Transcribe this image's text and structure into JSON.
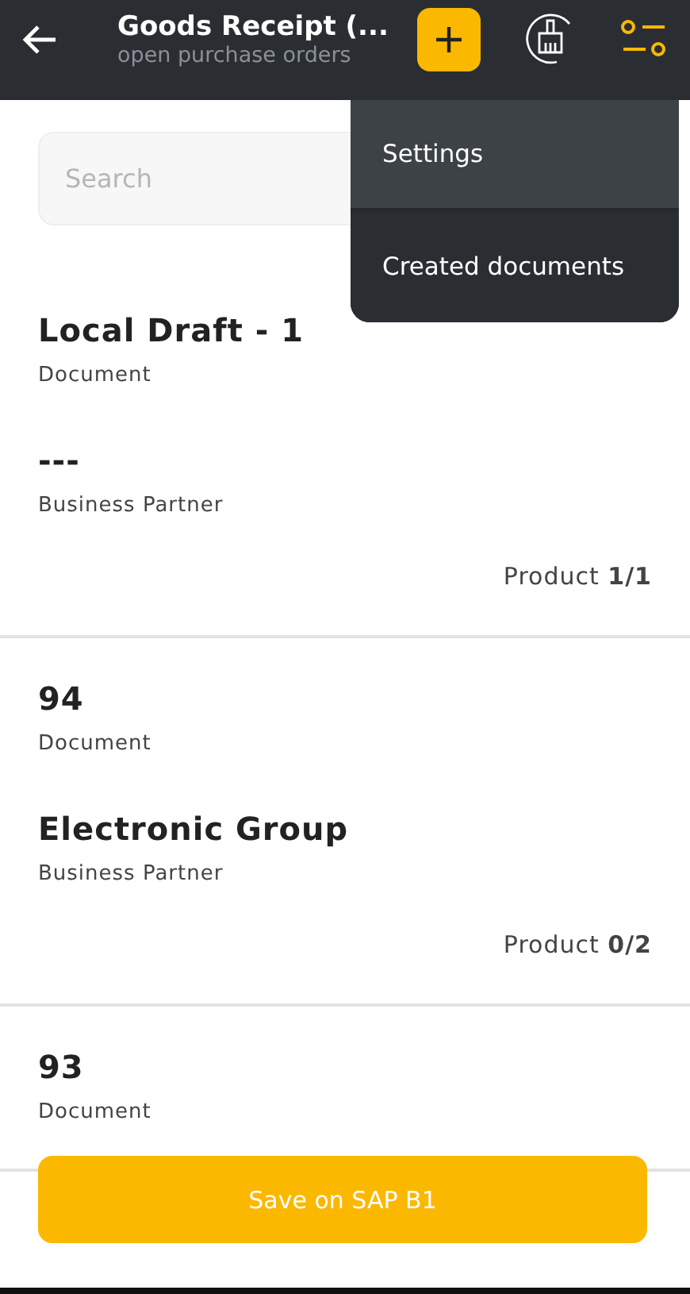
{
  "header": {
    "title": "Goods Receipt (...",
    "subtitle": "open purchase orders"
  },
  "menu": [
    {
      "label": "Settings",
      "selected": true
    },
    {
      "label": "Created documents",
      "selected": false
    }
  ],
  "search": {
    "placeholder": "Search"
  },
  "documents": [
    {
      "document": "Local Draft - 1",
      "document_label": "Document",
      "partner": "---",
      "partner_label": "Business Partner",
      "products": "Product **1/1**"
    },
    {
      "document": "94",
      "document_label": "Document",
      "partner": "Electronic Group",
      "partner_label": "Business Partner",
      "products": "Product **0/2**"
    },
    {
      "document": "93",
      "document_label": "Document"
    }
  ],
  "save_button": "Save on SAP B1"
}
